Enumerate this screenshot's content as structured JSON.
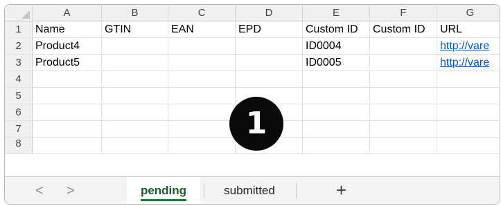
{
  "columns": [
    "A",
    "B",
    "C",
    "D",
    "E",
    "F",
    "G"
  ],
  "rows": [
    {
      "num": "1",
      "cells": [
        "Name",
        "GTIN",
        "EAN",
        "EPD",
        "Custom ID",
        "Custom ID",
        "URL"
      ]
    },
    {
      "num": "2",
      "cells": [
        "Product4",
        "",
        "",
        "",
        "ID0004",
        "",
        "http://vare"
      ]
    },
    {
      "num": "3",
      "cells": [
        "Product5",
        "",
        "",
        "",
        "ID0005",
        "",
        "http://vare"
      ]
    },
    {
      "num": "4",
      "cells": [
        "",
        "",
        "",
        "",
        "",
        "",
        ""
      ]
    },
    {
      "num": "5",
      "cells": [
        "",
        "",
        "",
        "",
        "",
        "",
        ""
      ]
    },
    {
      "num": "6",
      "cells": [
        "",
        "",
        "",
        "",
        "",
        "",
        ""
      ]
    },
    {
      "num": "7",
      "cells": [
        "",
        "",
        "",
        "",
        "",
        "",
        ""
      ]
    },
    {
      "num": "8",
      "cells": [
        "",
        "",
        "",
        "",
        "",
        "",
        ""
      ]
    }
  ],
  "marker": "1",
  "tabs": {
    "prev": "<",
    "next": ">",
    "sheets": [
      "pending",
      "submitted"
    ],
    "active": "pending",
    "add": "+"
  },
  "colors": {
    "link": "#0b52d6",
    "active_tab_underline": "#1f7a3a"
  }
}
